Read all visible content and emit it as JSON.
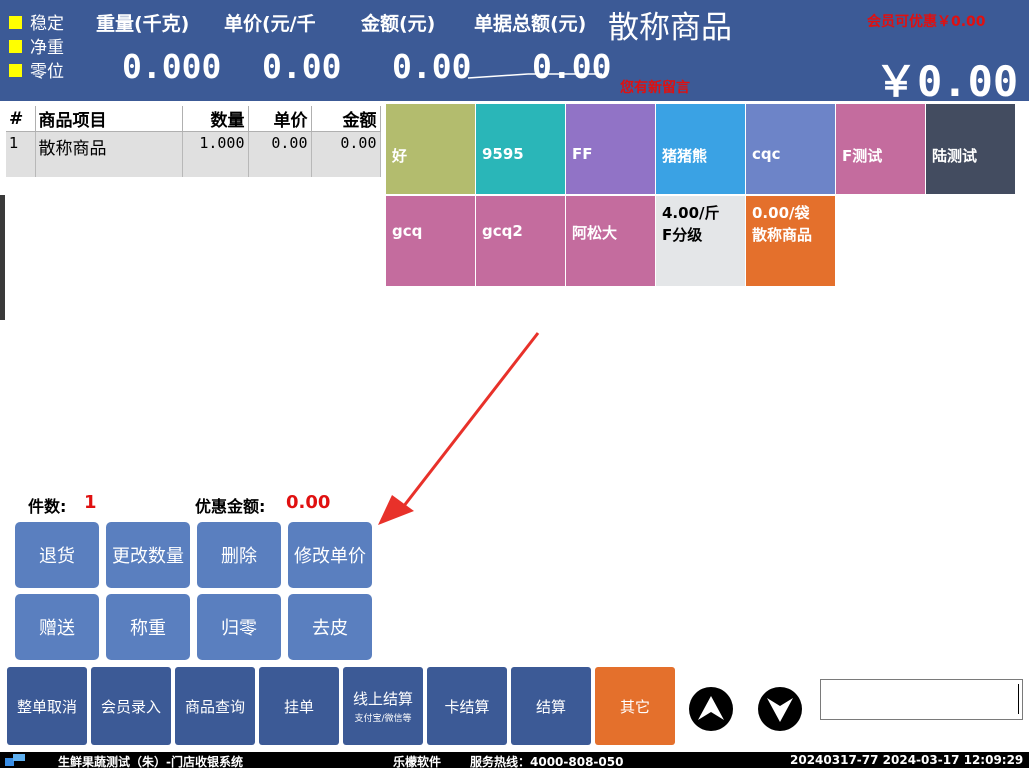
{
  "header": {
    "indicators": [
      "稳定",
      "净重",
      "零位"
    ],
    "labels": {
      "weight": "重量(千克)",
      "unit_price": "单价(元/千",
      "amount": "金额(元)",
      "receipt_total": "单据总额(元)"
    },
    "values": {
      "weight": "0.000",
      "unit_price": "0.00",
      "amount": "0.00",
      "receipt_total_struck": "0.00"
    },
    "receipt_title": "散称商品",
    "member_discount": "会员可优惠￥0.00",
    "message_alert": "您有新留言",
    "big_total": "￥0.00"
  },
  "items_table": {
    "columns": [
      "#",
      "商品项目",
      "数量",
      "单价",
      "金额"
    ],
    "rows": [
      {
        "no": "1",
        "name": "散称商品",
        "qty": "1.000",
        "price": "0.00",
        "amount": "0.00"
      }
    ]
  },
  "product_tiles": [
    {
      "line1": "好",
      "line2": "",
      "color": "#b3bc6e"
    },
    {
      "line1": "9595",
      "line2": "",
      "color": "#2ab6b8"
    },
    {
      "line1": "FF",
      "line2": "",
      "color": "#9173c6"
    },
    {
      "line1": "猪猪熊",
      "line2": "",
      "color": "#3aa2e4"
    },
    {
      "line1": "cqc",
      "line2": "",
      "color": "#6d84c8"
    },
    {
      "line1": "F测试",
      "line2": "",
      "color": "#c46c9e"
    },
    {
      "line1": "陆测试",
      "line2": "",
      "color": "#434c60"
    },
    {
      "line1": "gcq",
      "line2": "",
      "color": "#c46c9e"
    },
    {
      "line1": "gcq2",
      "line2": "",
      "color": "#c46c9e"
    },
    {
      "line1": "阿松大",
      "line2": "",
      "color": "#c46c9e"
    },
    {
      "line1": "4.00/斤",
      "line2": "F分级",
      "color": "#e4e6e8"
    },
    {
      "line1": "0.00/袋",
      "line2": "散称商品",
      "color": "#e4702c"
    }
  ],
  "summary": {
    "count_label": "件数:",
    "count_value": "1",
    "discount_label": "优惠金额:",
    "discount_value": "0.00"
  },
  "function_buttons": [
    "退货",
    "更改数量",
    "删除",
    "修改单价",
    "赠送",
    "称重",
    "归零",
    "去皮"
  ],
  "bottom_buttons": [
    {
      "label": "整单取消",
      "sub": ""
    },
    {
      "label": "会员录入",
      "sub": ""
    },
    {
      "label": "商品查询",
      "sub": ""
    },
    {
      "label": "挂单",
      "sub": ""
    },
    {
      "label": "线上结算",
      "sub": "支付宝/微信等"
    },
    {
      "label": "卡结算",
      "sub": ""
    },
    {
      "label": "结算",
      "sub": ""
    },
    {
      "label": "其它",
      "sub": ""
    }
  ],
  "status_bar": {
    "store": "生鲜果蔬测试（朱）-门店收银系统",
    "vendor": "乐檬软件",
    "hotline": "服务热线：4000-808-050",
    "receipt_info": "20240317-77 2024-03-17 12:09:29"
  },
  "colors": {
    "header_bg": "#3c5a96",
    "function_button": "#5a7fbf",
    "other_button": "#e4702c",
    "accent_red": "#e01010",
    "indicator_yellow": "#ffff00"
  }
}
